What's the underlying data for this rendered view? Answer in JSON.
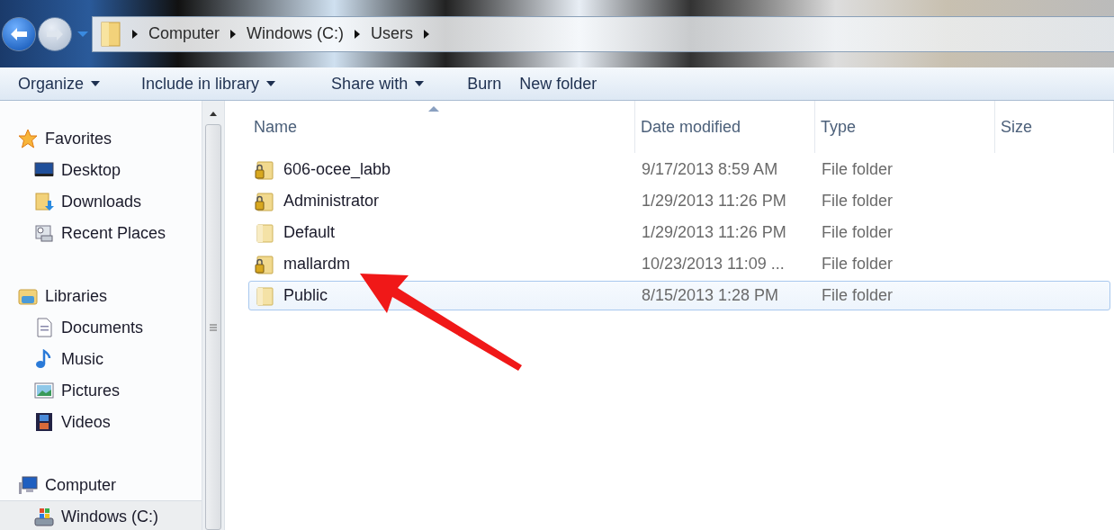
{
  "address_bar": {
    "crumbs": [
      "Computer",
      "Windows (C:)",
      "Users"
    ]
  },
  "toolbar": [
    {
      "label": "Organize",
      "dropdown": true
    },
    {
      "label": "Include in library",
      "dropdown": true
    },
    {
      "label": "Share with",
      "dropdown": true
    },
    {
      "label": "Burn",
      "dropdown": false
    },
    {
      "label": "New folder",
      "dropdown": false
    }
  ],
  "sidebar": {
    "groups": [
      {
        "label": "Favorites",
        "kind": "star",
        "selected": false,
        "children": [
          {
            "label": "Desktop",
            "kind": "desktop",
            "selected": false
          },
          {
            "label": "Downloads",
            "kind": "downloads",
            "selected": false
          },
          {
            "label": "Recent Places",
            "kind": "recent",
            "selected": false
          }
        ]
      },
      {
        "label": "Libraries",
        "kind": "library",
        "selected": false,
        "children": [
          {
            "label": "Documents",
            "kind": "document",
            "selected": false
          },
          {
            "label": "Music",
            "kind": "music",
            "selected": false
          },
          {
            "label": "Pictures",
            "kind": "pictures",
            "selected": false
          },
          {
            "label": "Videos",
            "kind": "videos",
            "selected": false
          }
        ]
      },
      {
        "label": "Computer",
        "kind": "computer",
        "selected": false,
        "children": [
          {
            "label": "Windows (C:)",
            "kind": "drive",
            "selected": true
          }
        ]
      }
    ]
  },
  "table": {
    "columns": [
      "Name",
      "Date modified",
      "Type",
      "Size"
    ],
    "rows": [
      {
        "name": "606-ocee_labb",
        "date": "9/17/2013 8:59 AM",
        "type": "File folder",
        "locked": true,
        "selected": false
      },
      {
        "name": "Administrator",
        "date": "1/29/2013 11:26 PM",
        "type": "File folder",
        "locked": true,
        "selected": false
      },
      {
        "name": "Default",
        "date": "1/29/2013 11:26 PM",
        "type": "File folder",
        "locked": false,
        "selected": false
      },
      {
        "name": "mallardm",
        "date": "10/23/2013 11:09 ...",
        "type": "File folder",
        "locked": true,
        "selected": false
      },
      {
        "name": "Public",
        "date": "8/15/2013 1:28 PM",
        "type": "File folder",
        "locked": false,
        "selected": true
      }
    ]
  },
  "annotation": {
    "kind": "arrow"
  }
}
